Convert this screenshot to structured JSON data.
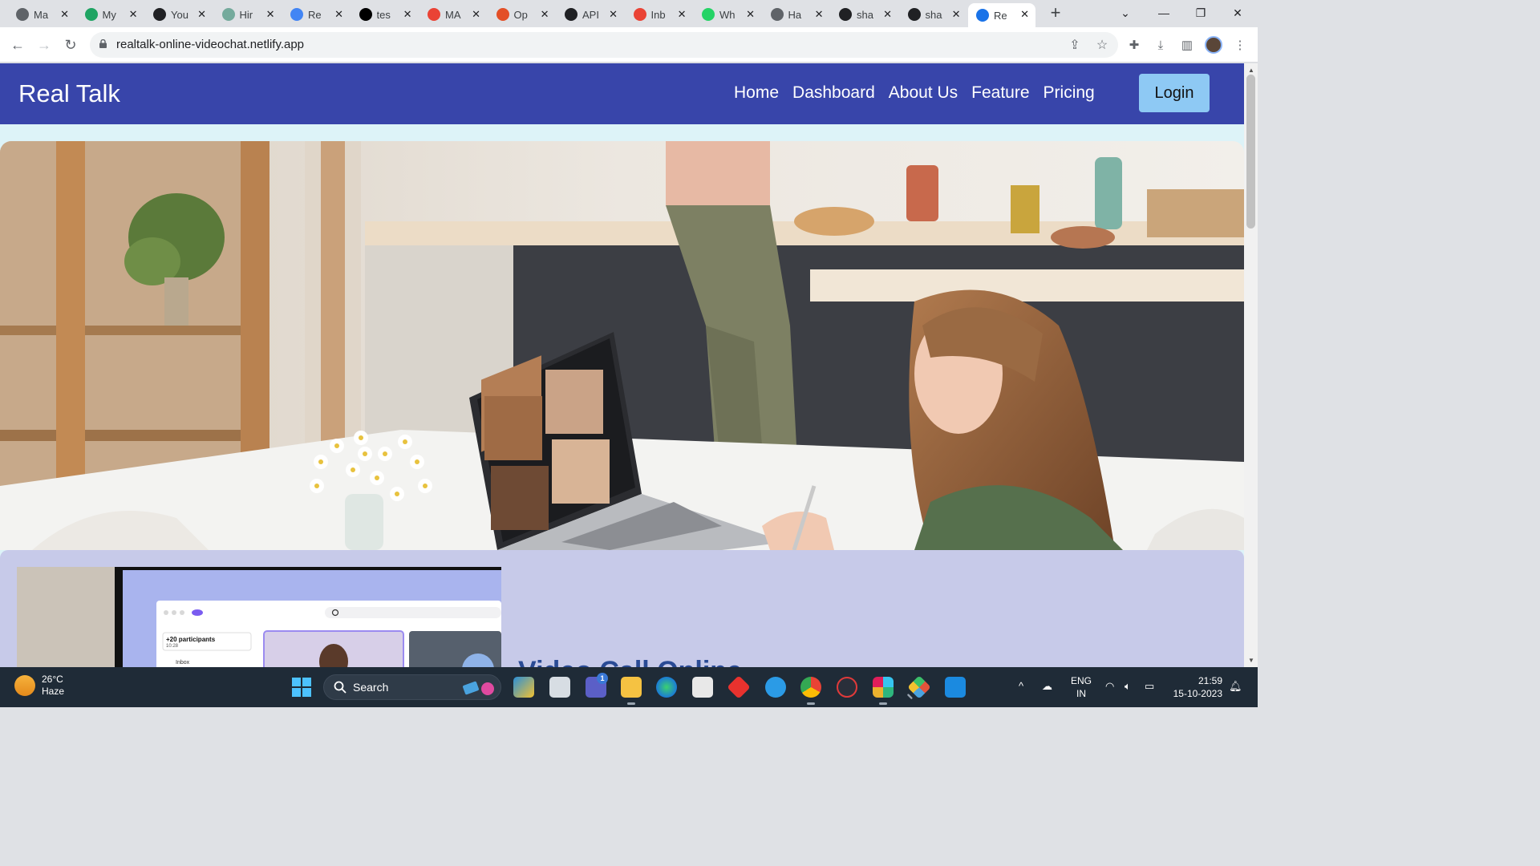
{
  "browser": {
    "tabs": [
      {
        "label": "Ma",
        "favicon": "globe-icon",
        "color": "#5f6368"
      },
      {
        "label": "My",
        "favicon": "drive-icon",
        "color": "#1fa463"
      },
      {
        "label": "You",
        "favicon": "github-icon",
        "color": "#202124"
      },
      {
        "label": "Hir",
        "favicon": "chatgpt-icon",
        "color": "#74aa9c"
      },
      {
        "label": "Re",
        "favicon": "docs-icon",
        "color": "#4285f4"
      },
      {
        "label": "tes",
        "favicon": "vercel-icon",
        "color": "#000000"
      },
      {
        "label": "MA",
        "favicon": "gmail-icon",
        "color": "#ea4335"
      },
      {
        "label": "Op",
        "favicon": "openai-icon",
        "color": "#e34f26"
      },
      {
        "label": "API",
        "favicon": "openai-icon",
        "color": "#202124"
      },
      {
        "label": "Inb",
        "favicon": "gmail-icon",
        "color": "#ea4335"
      },
      {
        "label": "Wh",
        "favicon": "whatsapp-icon",
        "color": "#25d366"
      },
      {
        "label": "Ha",
        "favicon": "globe-icon",
        "color": "#5f6368"
      },
      {
        "label": "sha",
        "favicon": "github-icon",
        "color": "#202124"
      },
      {
        "label": "sha",
        "favicon": "github-icon",
        "color": "#202124"
      },
      {
        "label": "Re",
        "favicon": "realtalk-icon",
        "color": "#1a73e8"
      }
    ],
    "url": "realtalk-online-videochat.netlify.app"
  },
  "site": {
    "brand": "Real Talk",
    "nav": [
      "Home",
      "Dashboard",
      "About Us",
      "Feature",
      "Pricing"
    ],
    "login": "Login",
    "section_title": "Video Call Online",
    "mock_ui": {
      "participants": "+20 participants",
      "time": "10:28",
      "inbox": "Inbox"
    }
  },
  "taskbar": {
    "temp": "26°C",
    "weather": "Haze",
    "search": "Search",
    "lang": "ENG",
    "region": "IN",
    "time": "21:59",
    "date": "15-10-2023",
    "badge": "1"
  }
}
